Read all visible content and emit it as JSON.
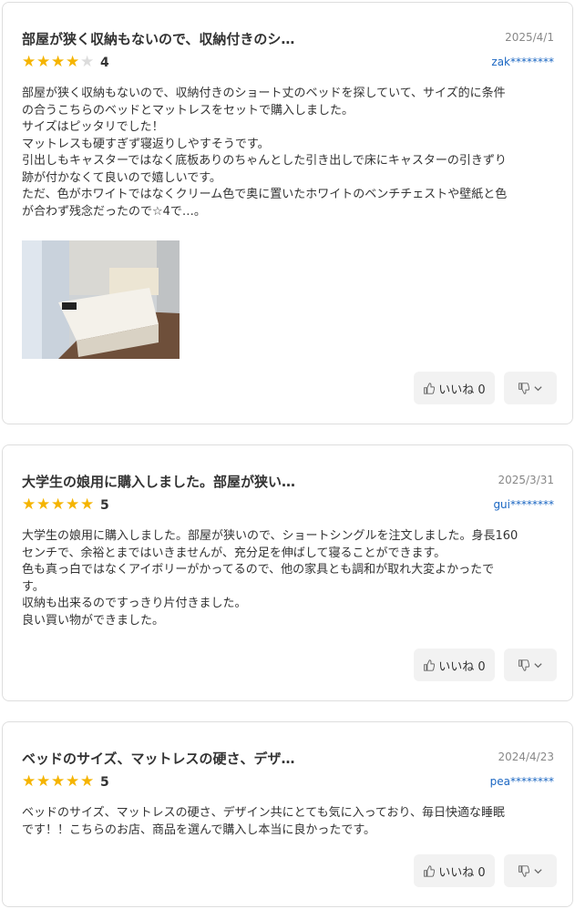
{
  "reviews": [
    {
      "title": "部屋が狭く収納もないので、収納付きのシ…",
      "date": "2025/4/1",
      "rating": 4,
      "rating_label": "4",
      "user": "zak********",
      "body": "部屋が狭く収納もないので、収納付きのショート丈のベッドを探していて、サイズ的に条件\nの合うこちらのベッドとマットレスをセットで購入しました。\nサイズはピッタリでした！\nマットレスも硬すぎず寝返りしやすそうです。\n引出しもキャスターではなく底板ありのちゃんとした引き出しで床にキャスターの引きずり\n跡が付かなくて良いので嬉しいです。\nただ、色がホワイトではなくクリーム色で奥に置いたホワイトのベンチチェストや壁紙と色\nが合わず残念だったので☆4で…。",
      "like_label": "いいね 0"
    },
    {
      "title": "大学生の娘用に購入しました。部屋が狭い…",
      "date": "2025/3/31",
      "rating": 5,
      "rating_label": "5",
      "user": "gui********",
      "body": "大学生の娘用に購入しました。部屋が狭いので、ショートシングルを注文しました。身長160\nセンチで、余裕とまではいきませんが、充分足を伸ばして寝ることができます。\n色も真っ白ではなくアイボリーがかってるので、他の家具とも調和が取れ大変よかったで\nす。\n収納も出来るのですっきり片付きました。\n良い買い物ができました。",
      "like_label": "いいね 0"
    },
    {
      "title": "ベッドのサイズ、マットレスの硬さ、デザ…",
      "date": "2024/4/23",
      "rating": 5,
      "rating_label": "5",
      "user": "pea********",
      "body": "ベッドのサイズ、マットレスの硬さ、デザイン共にとても気に入っており、毎日快適な睡眠\nです！！こちらのお店、商品を選んで購入し本当に良かったです。",
      "like_label": "いいね 0"
    }
  ],
  "colors": {
    "star_on": "#f5b400",
    "star_off": "#dcdcdc",
    "user_link": "#1a66c2",
    "border": "#dedede",
    "button_bg": "#f2f2f2"
  },
  "icons": {
    "star": "star-icon",
    "like": "thumbs-up-icon",
    "dislike": "thumbs-down-icon",
    "chevron": "chevron-down-icon"
  }
}
